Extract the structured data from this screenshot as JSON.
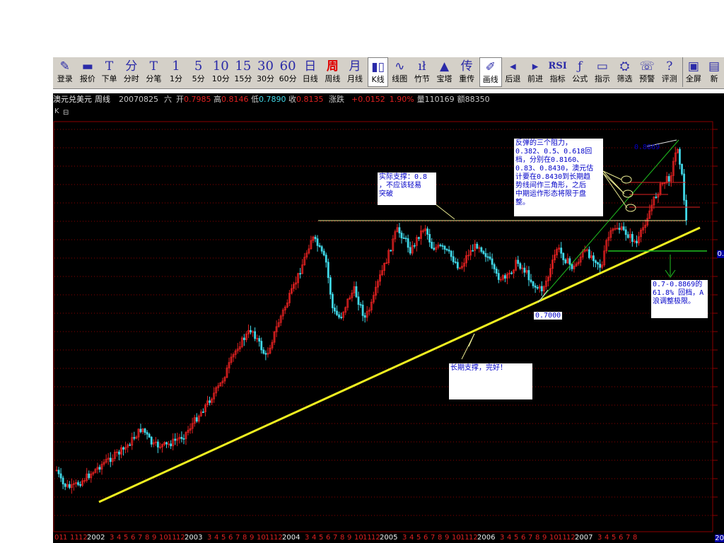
{
  "toolbar": {
    "items": [
      {
        "icon": "✎",
        "label": "登录",
        "name": "login"
      },
      {
        "icon": "▬",
        "label": "报价",
        "name": "quote"
      },
      {
        "icon": "T",
        "label": "下单",
        "name": "order"
      },
      {
        "icon": "分",
        "label": "分时",
        "name": "timeshare"
      },
      {
        "icon": "T",
        "label": "分笔",
        "name": "tick"
      },
      {
        "icon": "1",
        "label": "1分",
        "name": "1min"
      },
      {
        "icon": "5",
        "label": "5分",
        "name": "5min"
      },
      {
        "icon": "10",
        "label": "10分",
        "name": "10min"
      },
      {
        "icon": "15",
        "label": "15分",
        "name": "15min"
      },
      {
        "icon": "30",
        "label": "30分",
        "name": "30min"
      },
      {
        "icon": "60",
        "label": "60分",
        "name": "60min"
      },
      {
        "icon": "日",
        "label": "日线",
        "name": "daily"
      },
      {
        "icon": "周",
        "label": "周线",
        "name": "weekly"
      },
      {
        "icon": "月",
        "label": "月线",
        "name": "monthly"
      },
      {
        "icon": "▮▯",
        "label": "K线",
        "name": "kline"
      },
      {
        "icon": "∿",
        "label": "线图",
        "name": "linechart"
      },
      {
        "icon": "ıł",
        "label": "竹节",
        "name": "bamboo"
      },
      {
        "icon": "▲",
        "label": "宝塔",
        "name": "tower"
      },
      {
        "icon": "传",
        "label": "重传",
        "name": "resend"
      },
      {
        "icon": "✐",
        "label": "画线",
        "name": "draw"
      },
      {
        "icon": "◂",
        "label": "后退",
        "name": "back"
      },
      {
        "icon": "▸",
        "label": "前进",
        "name": "forward"
      },
      {
        "icon": "RSI",
        "label": "指标",
        "name": "indicator"
      },
      {
        "icon": "ƒ",
        "label": "公式",
        "name": "formula"
      },
      {
        "icon": "▭",
        "label": "指示",
        "name": "hint"
      },
      {
        "icon": "⛭",
        "label": "筛选",
        "name": "filter"
      },
      {
        "icon": "☏",
        "label": "预警",
        "name": "alert"
      },
      {
        "icon": "?",
        "label": "评测",
        "name": "evaluate"
      },
      {
        "icon": "▣",
        "label": "全屏",
        "name": "fullscreen"
      },
      {
        "icon": "▤",
        "label": "新",
        "name": "new"
      }
    ],
    "active_index": 12,
    "highlighted_index": 19
  },
  "info": {
    "symbol": "澳元兑美元",
    "period": "周线",
    "date": "20070825",
    "weekday": "六",
    "open_label": "开",
    "open": "0.7985",
    "high_label": "高",
    "high": "0.8146",
    "low_label": "低",
    "low": "0.7890",
    "close_label": "收",
    "close": "0.8135",
    "change_label": "涨跌",
    "change": "+0.0152",
    "change_pct": "1.90%",
    "volume_label": "量",
    "volume": "110169",
    "amount_label": "额",
    "amount": "88350"
  },
  "chart": {
    "k_button": "K",
    "collapse_icon": "⊟",
    "right_edge_label": "0.",
    "bottom_right_label": "20",
    "annotations": {
      "support_08": "实际支撑：0.8\n，不应该轻易\n突破",
      "resistance": "反弹的三个阻力，\n0.382、0.5、0.618回\n档，分别在0.8160、\n0.83、0.8430，澳元估\n计要在0.8430到长期趋\n势线间作三角形，之后\n中期运作形态将限于盘\n整。",
      "long_support": "长期支撑，完好！",
      "retrace": "0.7-0.8869的\n61.8% 回档，A\n浪调整极限。"
    },
    "labels": {
      "low_point": "0.7000",
      "high_point": "0.8869"
    },
    "x_axis": [
      {
        "t": "01",
        "yr": false
      },
      {
        "t": "1",
        "yr": false
      },
      {
        "t": "11",
        "yr": false
      },
      {
        "t": "12",
        "yr": false
      },
      {
        "t": "2002",
        "yr": true
      },
      {
        "t": "3",
        "yr": false
      },
      {
        "t": "4",
        "yr": false
      },
      {
        "t": "5",
        "yr": false
      },
      {
        "t": "6",
        "yr": false
      },
      {
        "t": "7",
        "yr": false
      },
      {
        "t": "8",
        "yr": false
      },
      {
        "t": "9",
        "yr": false
      },
      {
        "t": "10",
        "yr": false
      },
      {
        "t": "11",
        "yr": false
      },
      {
        "t": "12",
        "yr": false
      },
      {
        "t": "2003",
        "yr": true
      },
      {
        "t": "3",
        "yr": false
      },
      {
        "t": "4",
        "yr": false
      },
      {
        "t": "5",
        "yr": false
      },
      {
        "t": "6",
        "yr": false
      },
      {
        "t": "7",
        "yr": false
      },
      {
        "t": "8",
        "yr": false
      },
      {
        "t": "9",
        "yr": false
      },
      {
        "t": "10",
        "yr": false
      },
      {
        "t": "11",
        "yr": false
      },
      {
        "t": "12",
        "yr": false
      },
      {
        "t": "2004",
        "yr": true
      },
      {
        "t": "3",
        "yr": false
      },
      {
        "t": "4",
        "yr": false
      },
      {
        "t": "5",
        "yr": false
      },
      {
        "t": "6",
        "yr": false
      },
      {
        "t": "7",
        "yr": false
      },
      {
        "t": "8",
        "yr": false
      },
      {
        "t": "9",
        "yr": false
      },
      {
        "t": "10",
        "yr": false
      },
      {
        "t": "11",
        "yr": false
      },
      {
        "t": "12",
        "yr": false
      },
      {
        "t": "2005",
        "yr": true
      },
      {
        "t": "3",
        "yr": false
      },
      {
        "t": "4",
        "yr": false
      },
      {
        "t": "5",
        "yr": false
      },
      {
        "t": "6",
        "yr": false
      },
      {
        "t": "7",
        "yr": false
      },
      {
        "t": "8",
        "yr": false
      },
      {
        "t": "9",
        "yr": false
      },
      {
        "t": "10",
        "yr": false
      },
      {
        "t": "11",
        "yr": false
      },
      {
        "t": "12",
        "yr": false
      },
      {
        "t": "2006",
        "yr": true
      },
      {
        "t": "3",
        "yr": false
      },
      {
        "t": "4",
        "yr": false
      },
      {
        "t": "5",
        "yr": false
      },
      {
        "t": "6",
        "yr": false
      },
      {
        "t": "7",
        "yr": false
      },
      {
        "t": "8",
        "yr": false
      },
      {
        "t": "9",
        "yr": false
      },
      {
        "t": "10",
        "yr": false
      },
      {
        "t": "11",
        "yr": false
      },
      {
        "t": "12",
        "yr": false
      },
      {
        "t": "2007",
        "yr": true
      },
      {
        "t": "3",
        "yr": false
      },
      {
        "t": "4",
        "yr": false
      },
      {
        "t": "5",
        "yr": false
      },
      {
        "t": "6",
        "yr": false
      },
      {
        "t": "7",
        "yr": false
      },
      {
        "t": "8",
        "yr": false
      }
    ]
  },
  "colors": {
    "up": "#e02020",
    "down": "#40d8e8",
    "trendline": "#f0f020",
    "support": "#e8e890",
    "grid": "#8b0000",
    "annotation_text": "#0000c8",
    "background": "#000000",
    "green_line": "#20c020"
  }
}
